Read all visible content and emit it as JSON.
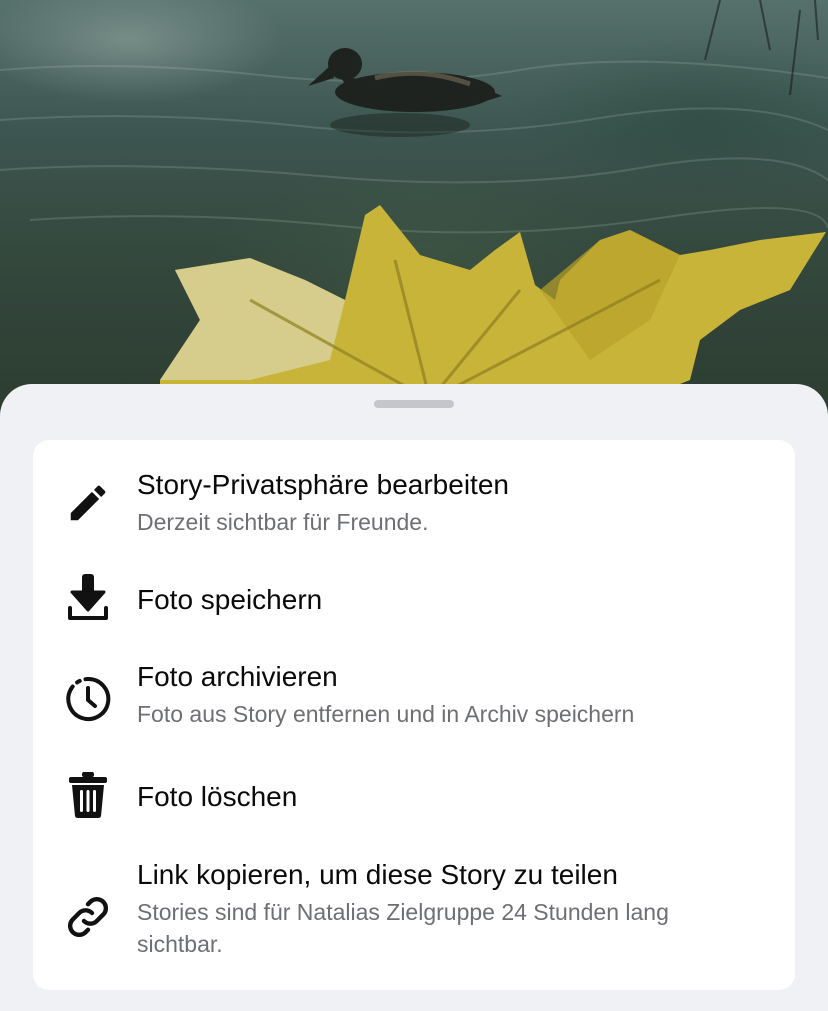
{
  "sheet": {
    "items": [
      {
        "icon": "pencil-icon",
        "title": "Story-Privatsphäre bearbeiten",
        "subtitle": "Derzeit sichtbar für Freunde."
      },
      {
        "icon": "download-icon",
        "title": "Foto speichern"
      },
      {
        "icon": "archive-clock-icon",
        "title": "Foto archivieren",
        "subtitle": "Foto aus Story entfernen und in Archiv speichern"
      },
      {
        "icon": "trash-icon",
        "title": "Foto löschen"
      },
      {
        "icon": "link-icon",
        "title": "Link kopieren, um diese Story zu teilen",
        "subtitle": "Stories sind für Natalias Zielgruppe 24 Stunden lang sichtbar."
      }
    ]
  },
  "colors": {
    "sheet_background": "#f0f1f4",
    "card_background": "#ffffff",
    "title_text": "#0a0a0a",
    "subtitle_text": "#6d6f73"
  }
}
